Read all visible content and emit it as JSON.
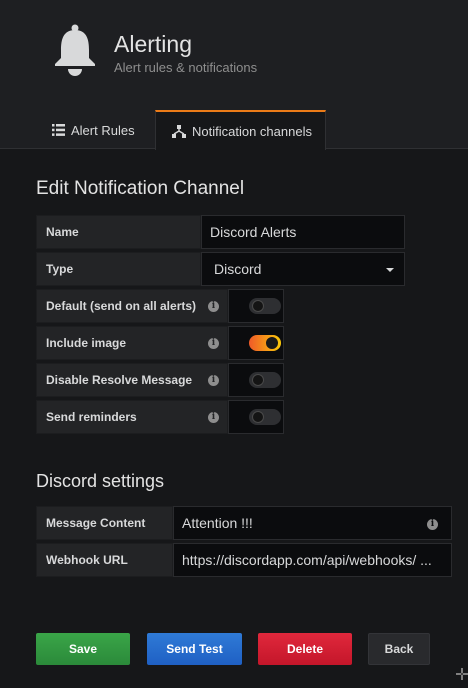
{
  "header": {
    "icon": "bell-icon",
    "title": "Alerting",
    "subtitle": "Alert rules & notifications"
  },
  "tabs": [
    {
      "label": "Alert Rules",
      "icon": "list-icon",
      "active": false
    },
    {
      "label": "Notification channels",
      "icon": "sitemap-icon",
      "active": true
    }
  ],
  "edit": {
    "title": "Edit Notification Channel",
    "name_label": "Name",
    "name_value": "Discord Alerts",
    "type_label": "Type",
    "type_value": "Discord",
    "toggles": [
      {
        "label": "Default (send on all alerts)",
        "on": false
      },
      {
        "label": "Include image",
        "on": true
      },
      {
        "label": "Disable Resolve Message",
        "on": false
      },
      {
        "label": "Send reminders",
        "on": false
      }
    ]
  },
  "discord": {
    "title": "Discord settings",
    "message_label": "Message Content",
    "message_value": "Attention !!!",
    "webhook_label": "Webhook URL",
    "webhook_value": "https://discordapp.com/api/webhooks/ ..."
  },
  "buttons": {
    "save": "Save",
    "send_test": "Send Test",
    "delete": "Delete",
    "back": "Back"
  },
  "colors": {
    "accent": "#eb7b18",
    "save": "#2b8a3a",
    "test": "#1f60c4",
    "delete": "#c4162a"
  }
}
